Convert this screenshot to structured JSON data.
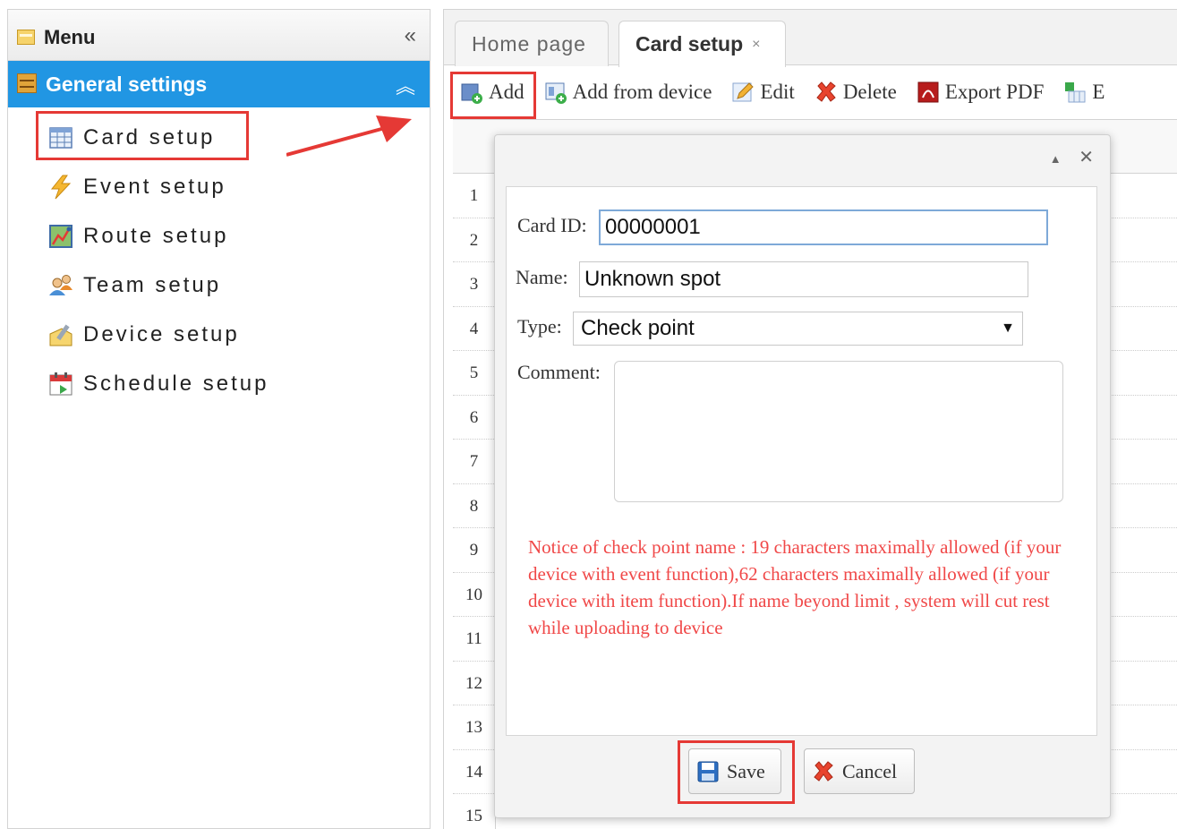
{
  "sidebar": {
    "title": "Menu",
    "collapse_icon": "«",
    "section": {
      "title": "General settings",
      "toggle_icon": "︽"
    },
    "items": [
      {
        "label": "Card setup",
        "icon": "table-icon"
      },
      {
        "label": "Event setup",
        "icon": "lightning-icon"
      },
      {
        "label": "Route setup",
        "icon": "map-icon"
      },
      {
        "label": "Team setup",
        "icon": "users-icon"
      },
      {
        "label": "Device setup",
        "icon": "device-edit-icon"
      },
      {
        "label": "Schedule setup",
        "icon": "calendar-icon"
      }
    ]
  },
  "tabs": [
    {
      "label": "Home page"
    },
    {
      "label": "Card setup",
      "close": "×"
    }
  ],
  "toolbar": {
    "add": "Add",
    "add_from_device": "Add from device",
    "edit": "Edit",
    "delete": "Delete",
    "export_pdf": "Export PDF",
    "export_cut": "E"
  },
  "grid": {
    "rows": [
      "1",
      "2",
      "3",
      "4",
      "5",
      "6",
      "7",
      "8",
      "9",
      "10",
      "11",
      "12",
      "13",
      "14",
      "15"
    ]
  },
  "dialog": {
    "controls": {
      "collapse": "▲",
      "close": "✕"
    },
    "card_id_label": "Card ID:",
    "card_id_value": "00000001",
    "name_label": "Name:",
    "name_value": "Unknown spot",
    "type_label": "Type:",
    "type_value": "Check point",
    "type_caret": "▼",
    "comment_label": "Comment:",
    "notice": "Notice of check point name : 19 characters maximally allowed (if your device with event function),62 characters maximally allowed (if your device with item function).If name beyond limit , system will cut rest while uploading to device",
    "save_label": "Save",
    "cancel_label": "Cancel"
  },
  "colors": {
    "accent": "#2196e3",
    "highlight": "#e53935",
    "notice": "#f04848"
  }
}
